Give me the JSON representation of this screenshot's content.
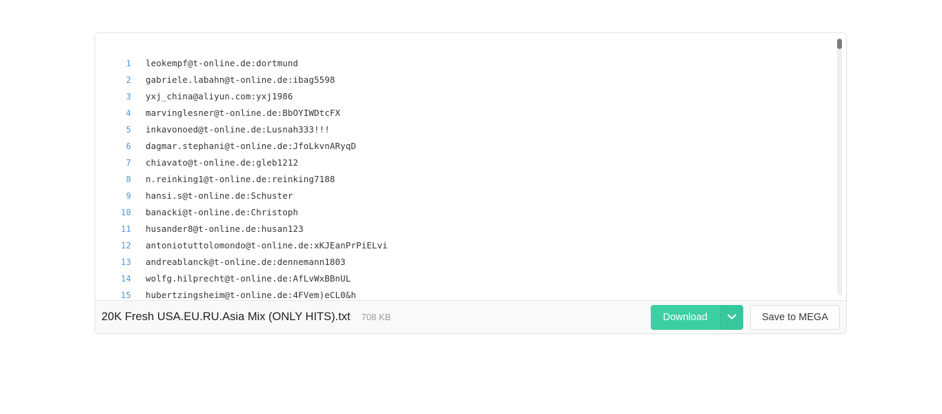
{
  "preview": {
    "lines": [
      {
        "n": "1",
        "text": "leokempf@t-online.de:dortmund"
      },
      {
        "n": "2",
        "text": "gabriele.labahn@t-online.de:ibag5598"
      },
      {
        "n": "3",
        "text": "yxj_china@aliyun.com:yxj1986"
      },
      {
        "n": "4",
        "text": "marvinglesner@t-online.de:BbOYIWDtcFX"
      },
      {
        "n": "5",
        "text": "inkavonoed@t-online.de:Lusnah333!!!"
      },
      {
        "n": "6",
        "text": "dagmar.stephani@t-online.de:JfoLkvnARyqD"
      },
      {
        "n": "7",
        "text": "chiavato@t-online.de:gleb1212"
      },
      {
        "n": "8",
        "text": "n.reinking1@t-online.de:reinking7188"
      },
      {
        "n": "9",
        "text": "hansi.s@t-online.de:Schuster"
      },
      {
        "n": "10",
        "text": "banacki@t-online.de:Christoph"
      },
      {
        "n": "11",
        "text": "husander8@t-online.de:husan123"
      },
      {
        "n": "12",
        "text": "antoniotuttolomondo@t-online.de:xKJEanPrPiELvi"
      },
      {
        "n": "13",
        "text": "andreablanck@t-online.de:dennemann1803"
      },
      {
        "n": "14",
        "text": "wolfg.hilprecht@t-online.de:AfLvWxBBnUL"
      },
      {
        "n": "15",
        "text": "hubertzingsheim@t-online.de:4FVem)eCL0&h"
      }
    ]
  },
  "footer": {
    "file_name": "20K Fresh USA.EU.RU.Asia Mix (ONLY HITS).txt",
    "file_size": "708 KB",
    "download_label": "Download",
    "save_to_mega_label": "Save to MEGA"
  },
  "colors": {
    "accent_green": "#3bd0a4",
    "accent_green_dark": "#37c79c",
    "line_number": "#4e95d9",
    "code_text": "#33363a"
  }
}
